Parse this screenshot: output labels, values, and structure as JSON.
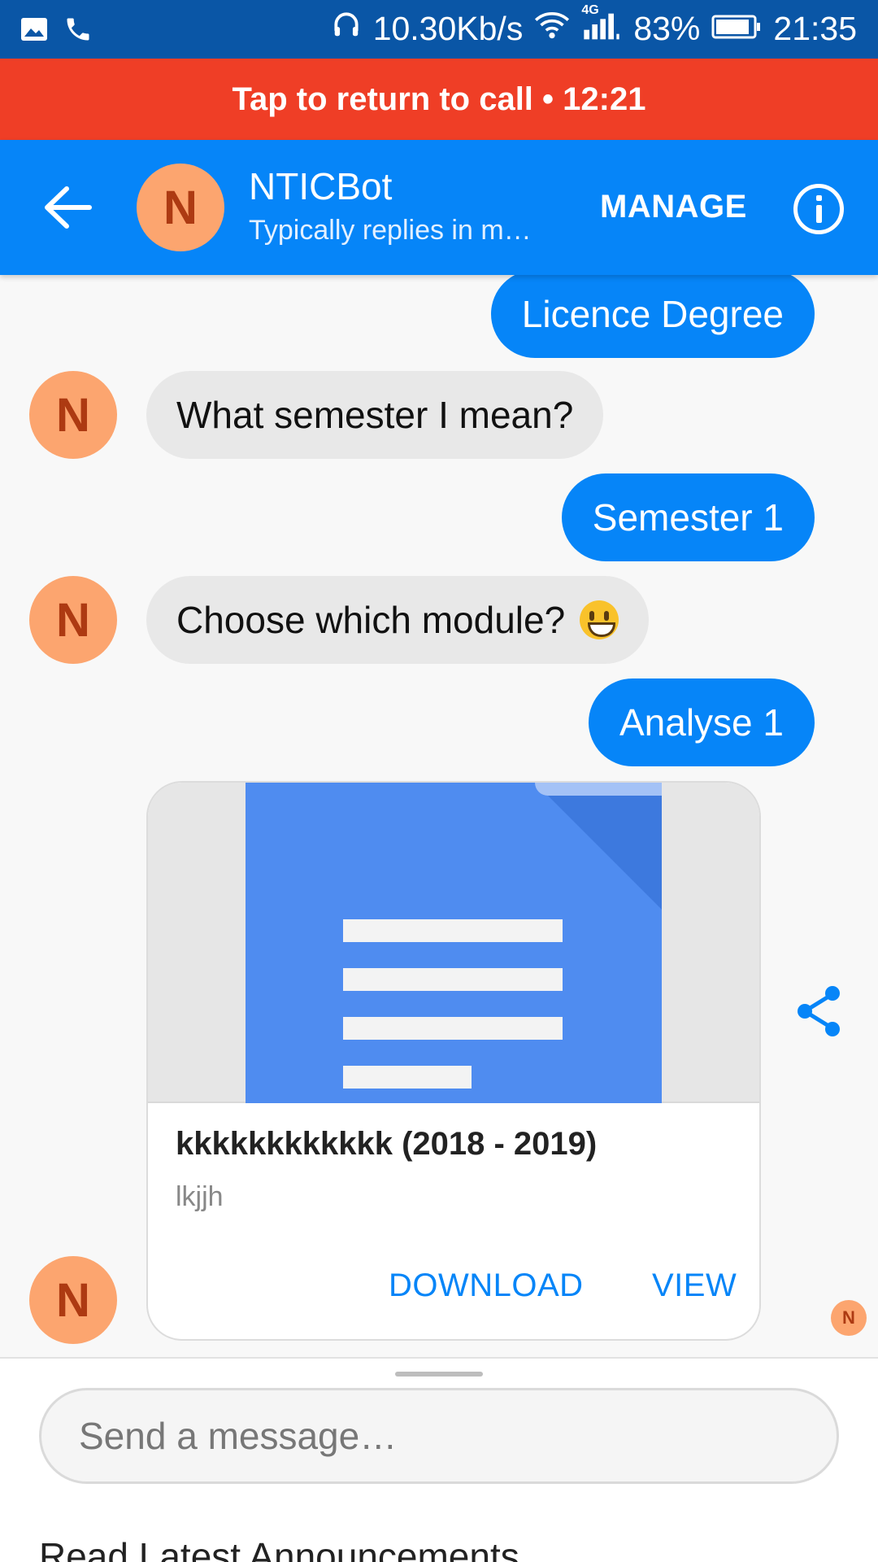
{
  "status_bar": {
    "net_speed": "10.30Kb/s",
    "network_type": "4G",
    "battery": "83%",
    "time": "21:35",
    "icons": [
      "image-icon",
      "phone-icon",
      "headphones-icon",
      "wifi-icon",
      "signal-icon",
      "battery-icon"
    ]
  },
  "call_banner": {
    "text": "Tap to return to call • 12:21",
    "color": "#ef3e26"
  },
  "header": {
    "title": "NTICBot",
    "subtitle": "Typically replies in m…",
    "avatar_letter": "N",
    "manage_label": "MANAGE",
    "color": "#0685f8"
  },
  "messages": [
    {
      "from": "user",
      "text": "Licence Degree"
    },
    {
      "from": "bot",
      "avatar": "N",
      "text": "What semester I mean?"
    },
    {
      "from": "user",
      "text": "Semester 1"
    },
    {
      "from": "bot",
      "avatar": "N",
      "text": "Choose which module?"
    },
    {
      "from": "user",
      "text": "Analyse 1"
    }
  ],
  "card": {
    "avatar": "N",
    "title": "kkkkkkkkkkkk (2018 - 2019)",
    "subtitle": "lkjjh",
    "download_label": "DOWNLOAD",
    "view_label": "VIEW"
  },
  "seen_avatar": "N",
  "composer": {
    "placeholder": "Send a message…",
    "menu_item": "Read Latest Announcements"
  }
}
